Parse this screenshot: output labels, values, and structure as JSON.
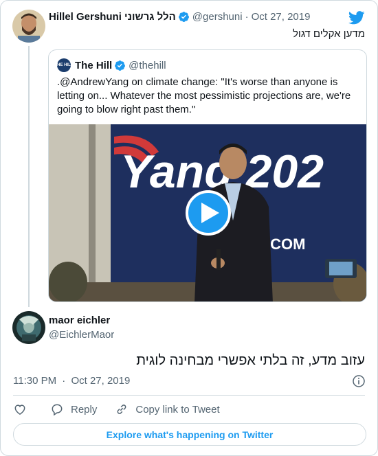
{
  "brand": {
    "accent": "#1d9bf0",
    "muted": "#536471",
    "border": "#cfd9de"
  },
  "parent_tweet": {
    "name": "Hillel Gershuni הלל גרשוני",
    "handle": "@gershuni",
    "date": "Oct 27, 2019",
    "text": "מדען אקלים דגול",
    "verified": true
  },
  "quoted_tweet": {
    "name": "The Hill",
    "handle": "@thehill",
    "avatar_text": "THE HILL",
    "text": ".@AndrewYang on climate change: \"It's worse than anyone is letting on... Whatever the most pessimistic projections are, we're going to blow right past them.\"",
    "media": {
      "type": "video",
      "banner_text": "Yang 202",
      "url_fragment": ".COM",
      "play_icon": "play-icon"
    }
  },
  "reply_tweet": {
    "name": "maor eichler",
    "handle": "@EichlerMaor",
    "text": "עזוב מדע, זה בלתי אפשרי מבחינה לוגית",
    "time": "11:30 PM",
    "date": "Oct 27, 2019"
  },
  "actions": {
    "like_icon": "heart-icon",
    "reply_label": "Reply",
    "copy_label": "Copy link to Tweet"
  },
  "explore": {
    "label": "Explore what's happening on Twitter"
  }
}
